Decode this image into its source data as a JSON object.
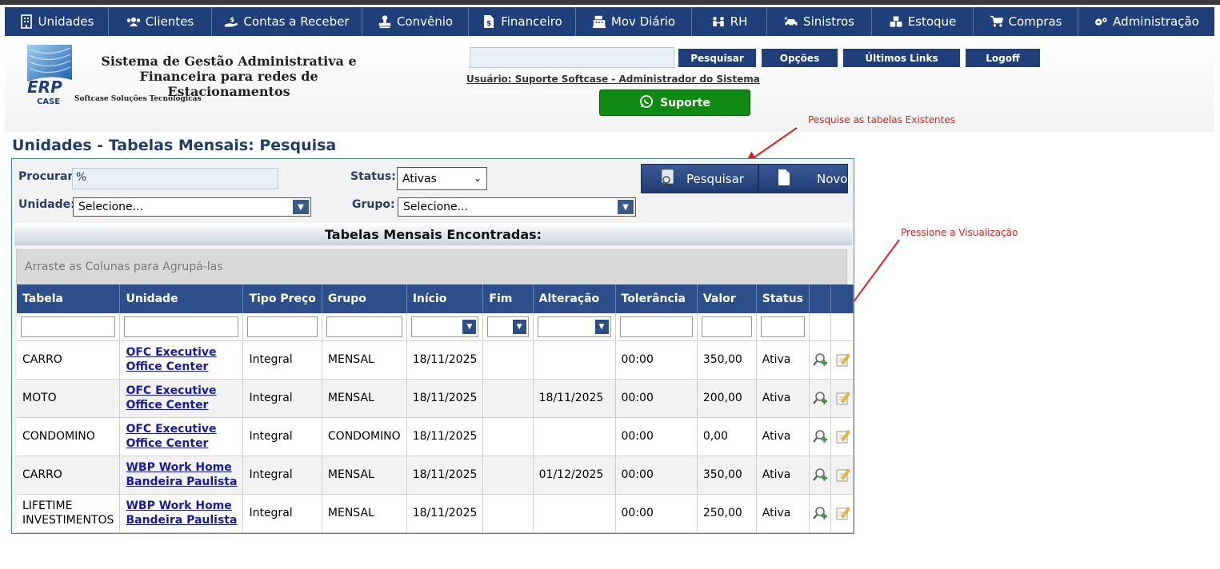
{
  "nav": [
    {
      "label": "Unidades",
      "icon": "building-icon",
      "w": 130
    },
    {
      "label": "Clientes",
      "icon": "users-icon",
      "w": 129
    },
    {
      "label": "Contas a Receber",
      "icon": "hand-money-icon",
      "w": 188
    },
    {
      "label": "Convênio",
      "icon": "stamp-icon",
      "w": 133
    },
    {
      "label": "Financeiro",
      "icon": "document-dollar-icon",
      "w": 134
    },
    {
      "label": "Mov Diário",
      "icon": "cash-register-icon",
      "w": 145
    },
    {
      "label": "RH",
      "icon": "people-icon",
      "w": 94
    },
    {
      "label": "Sinistros",
      "icon": "car-crash-icon",
      "w": 131
    },
    {
      "label": "Estoque",
      "icon": "boxes-icon",
      "w": 127
    },
    {
      "label": "Compras",
      "icon": "cart-icon",
      "w": 131
    },
    {
      "label": "Administração",
      "icon": "gears-icon",
      "w": 170
    }
  ],
  "header": {
    "logo_text": "ERP",
    "logo_sub": "CASE",
    "title_line1": "Sistema de Gestão Administrativa e",
    "title_line2": "Financeira para redes de Estacionamentos",
    "subtitle": "Softcase Soluções Tecnológicas",
    "search_value": "",
    "btn_pesquisar": "Pesquisar",
    "btn_opcoes": "Opções",
    "btn_links": "Últimos Links",
    "btn_logoff": "Logoff",
    "user": "Usuário: Suporte Softcase - Administrador do Sistema",
    "suporte": "Suporte"
  },
  "annotations": {
    "search_hint": "Pesquise as tabelas Existentes",
    "view_hint": "Pressione a Visualização"
  },
  "page": {
    "title": "Unidades - Tabelas Mensais: Pesquisa",
    "procurar_label": "Procurar:",
    "procurar_value": "%",
    "status_label": "Status:",
    "status_value": "Ativas",
    "unidade_label": "Unidade:",
    "unidade_value": "Selecione...",
    "grupo_label": "Grupo:",
    "grupo_value": "Selecione...",
    "btn_pesquisar": "Pesquisar",
    "btn_novo": "Novo",
    "found_title": "Tabelas Mensais Encontradas:",
    "group_hint": "Arraste as Colunas para Agrupá-las"
  },
  "table": {
    "columns": [
      "Tabela",
      "Unidade",
      "Tipo Preço",
      "Grupo",
      "Início",
      "Fim",
      "Alteração",
      "Tolerância",
      "Valor",
      "Status",
      ""
    ],
    "rows": [
      {
        "tabela": "CARRO",
        "unidade1": "OFC Executive",
        "unidade2": "Office Center",
        "tipo": "Integral",
        "grupo": "MENSAL",
        "inicio": "18/11/2025",
        "fim": "",
        "alteracao": "",
        "tolerancia": "00:00",
        "valor": "350,00",
        "status": "Ativa"
      },
      {
        "tabela": "MOTO",
        "unidade1": "OFC Executive",
        "unidade2": "Office Center",
        "tipo": "Integral",
        "grupo": "MENSAL",
        "inicio": "18/11/2025",
        "fim": "",
        "alteracao": "18/11/2025",
        "tolerancia": "00:00",
        "valor": "200,00",
        "status": "Ativa"
      },
      {
        "tabela": "CONDOMINO",
        "unidade1": "OFC Executive",
        "unidade2": "Office Center",
        "tipo": "Integral",
        "grupo": "CONDOMINO",
        "inicio": "18/11/2025",
        "fim": "",
        "alteracao": "",
        "tolerancia": "00:00",
        "valor": "0,00",
        "status": "Ativa"
      },
      {
        "tabela": "CARRO",
        "unidade1": "WBP Work Home",
        "unidade2": "Bandeira Paulista",
        "tipo": "Integral",
        "grupo": "MENSAL",
        "inicio": "18/11/2025",
        "fim": "",
        "alteracao": "01/12/2025",
        "tolerancia": "00:00",
        "valor": "350,00",
        "status": "Ativa"
      },
      {
        "tabela": "LIFETIME INVESTIMENTOS",
        "unidade1": "WBP Work Home",
        "unidade2": "Bandeira Paulista",
        "tipo": "Integral",
        "grupo": "MENSAL",
        "inicio": "18/11/2025",
        "fim": "",
        "alteracao": "",
        "tolerancia": "00:00",
        "valor": "250,00",
        "status": "Ativa"
      }
    ]
  },
  "colors": {
    "nav_bg": "#1f3f7a",
    "header_blue": "#2c4f8c",
    "link": "#1a1aa8",
    "annotation": "#e02020",
    "suporte_green": "#0f8a12"
  }
}
